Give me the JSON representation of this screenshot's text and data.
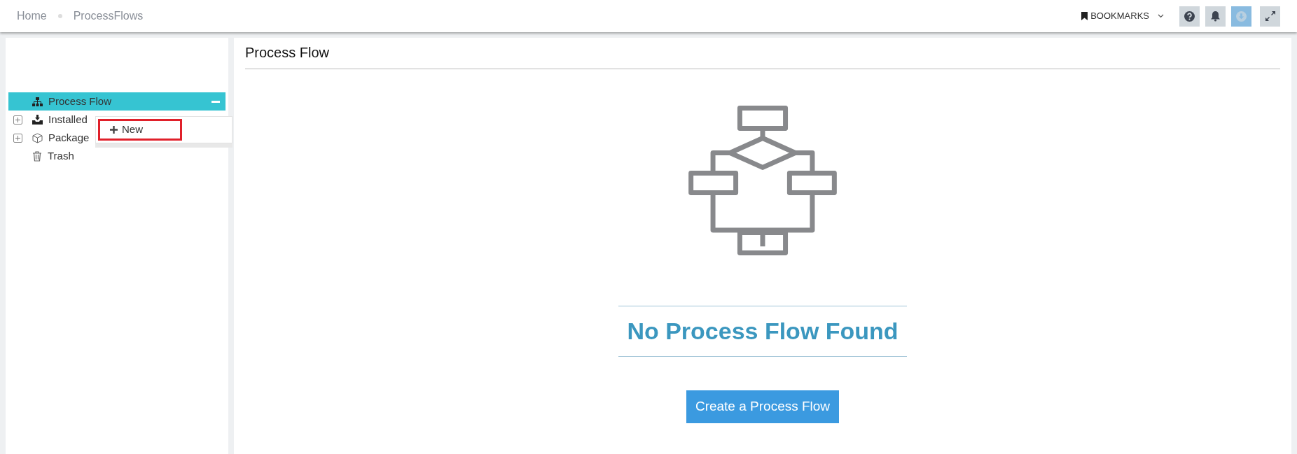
{
  "breadcrumb": [
    {
      "label": "Home"
    },
    {
      "label": "ProcessFlows"
    }
  ],
  "toolbar": {
    "bookmarks": "BOOKMARKS",
    "buttons": [
      {
        "kind": "help",
        "selected": false
      },
      {
        "kind": "bell",
        "selected": false
      },
      {
        "kind": "download",
        "selected": true
      },
      {
        "kind": "expand",
        "selected": false
      }
    ]
  },
  "sidebar": {
    "items": [
      {
        "label": "Process Flow",
        "kind": "sitemap",
        "expandable": false,
        "selected": true
      },
      {
        "label": "Installed",
        "kind": "inbox",
        "expandable": true,
        "selected": false
      },
      {
        "label": "Package",
        "kind": "box",
        "expandable": true,
        "selected": false
      },
      {
        "label": "Trash",
        "kind": "trash",
        "expandable": false,
        "selected": false
      }
    ],
    "context_menu": {
      "items": [
        {
          "label": "New",
          "highlighted": true
        }
      ]
    }
  },
  "main": {
    "title": "Process Flow",
    "empty_message": "No Process Flow Found",
    "button": "Create a Process Flow"
  }
}
